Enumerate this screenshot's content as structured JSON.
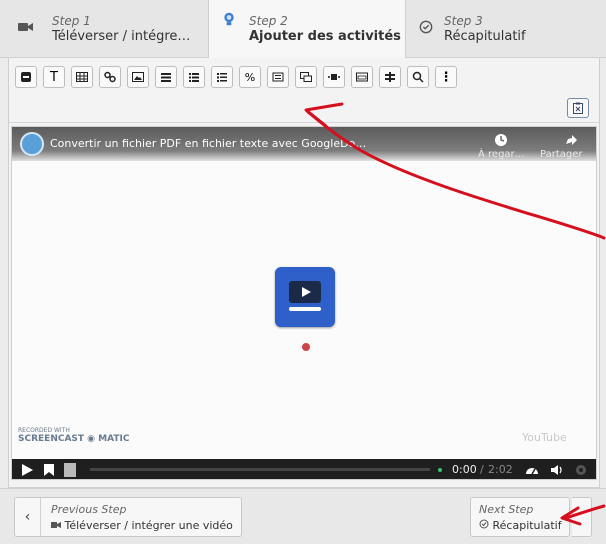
{
  "steps": [
    {
      "number": "Step 1",
      "title": "Téléverser / intégre…",
      "icon": "video-camera-icon"
    },
    {
      "number": "Step 2",
      "title": "Ajouter des activités",
      "icon": "lightbulb-icon"
    },
    {
      "number": "Step 3",
      "title": "Récapitulatif",
      "icon": "check-circle-icon"
    }
  ],
  "toolbar": {
    "buttons": [
      "block-icon",
      "text-icon",
      "table-icon",
      "link-icon",
      "image-icon",
      "summary-icon",
      "list-icon",
      "numbered-list-icon",
      "percent-icon",
      "slider-icon",
      "dialog-icon",
      "video-slide-icon",
      "image-gallery-icon",
      "cross-icon",
      "search-icon",
      "more-icon"
    ],
    "percent_glyph": "%",
    "text_glyph": "T",
    "more_glyph": "⋮"
  },
  "video": {
    "title": "Convertir un fichier PDF en fichier texte avec GoogleDo…",
    "watch_later": "À regar…",
    "share": "Partager",
    "watermark": "SCREENCAST ◉ MATIC",
    "watermark_sub": "RECORDED WITH",
    "youtube_mark": "YouTube",
    "time_current": "0:00",
    "time_total": "2:02"
  },
  "nav": {
    "prev_label": "Previous Step",
    "prev_target": "Téléverser / intégrer une vidéo",
    "next_label": "Next Step",
    "next_target": "Récapitulatif",
    "prev_chevron": "‹"
  },
  "colors": {
    "annotation": "#d4101e",
    "accent": "#2f5fc8"
  }
}
